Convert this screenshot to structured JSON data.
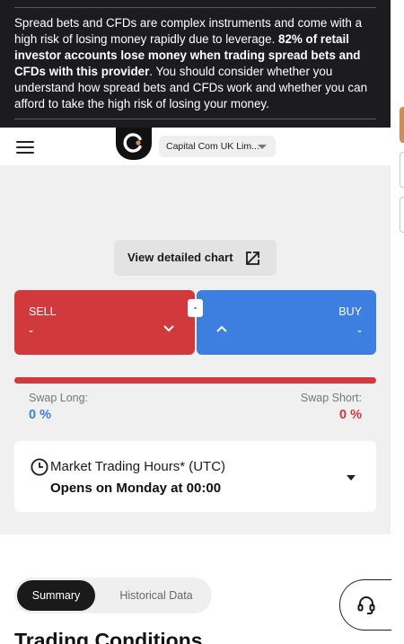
{
  "risk_warning": {
    "part1": "Spread bets and CFDs are complex instruments and come with a high risk of losing money rapidly due to leverage. ",
    "bold": "82% of retail investor accounts lose money when trading spread bets and CFDs with this provider",
    "part2": ". You should consider whether you understand how spread bets and CFDs work and whether you can afford to take the high risk of losing your money."
  },
  "header": {
    "entity_selector": "Capital Com UK Lim..."
  },
  "chart": {
    "view_button": "View detailed chart"
  },
  "trade": {
    "sell_label": "SELL",
    "sell_price": "-",
    "buy_label": "BUY",
    "buy_price": "-",
    "spread": "-"
  },
  "swap": {
    "long_label": "Swap Long:",
    "long_value": "0 %",
    "short_label": "Swap Short:",
    "short_value": "0 %"
  },
  "hours": {
    "title": "Market Trading Hours* (UTC)",
    "status": "Opens on Monday at 00:00"
  },
  "tabs": [
    {
      "label": "Summary"
    },
    {
      "label": "Historical Data"
    }
  ],
  "section": {
    "title": "Trading Conditions"
  },
  "colors": {
    "sell": "#d1393c",
    "buy": "#3d7fe0",
    "banner": "#1c1c1e",
    "accent": "#d38c4d"
  },
  "icons": {
    "menu": "menu-icon",
    "logo": "capital-com-logo",
    "external": "expand-icon",
    "clock": "clock-icon",
    "support": "headset-icon"
  }
}
